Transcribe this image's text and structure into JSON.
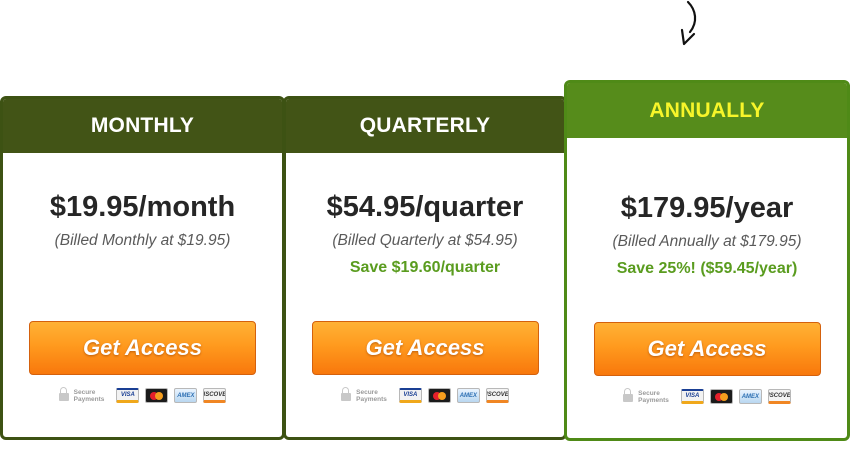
{
  "colors": {
    "header_dark": "#425416",
    "header_highlight": "#568c1b",
    "highlight_title": "#f7f52a",
    "save_green": "#5a9c1f",
    "button_orange": "#ff9a1e"
  },
  "plans": [
    {
      "title": "MONTHLY",
      "price": "$19.95/month",
      "billed": "(Billed Monthly at $19.95)",
      "save": "",
      "button": "Get Access"
    },
    {
      "title": "QUARTERLY",
      "price": "$54.95/quarter",
      "billed": "(Billed Quarterly at $54.95)",
      "save": "Save $19.60/quarter",
      "button": "Get Access"
    },
    {
      "title": "ANNUALLY",
      "price": "$179.95/year",
      "billed": "(Billed Annually at $179.95)",
      "save": "Save 25%!  ($59.45/year)",
      "button": "Get Access"
    }
  ],
  "payments": {
    "secure_line1": "Secure",
    "secure_line2": "Payments",
    "cards": [
      "VISA",
      "MasterCard",
      "AMEX",
      "DISCOVER"
    ]
  }
}
